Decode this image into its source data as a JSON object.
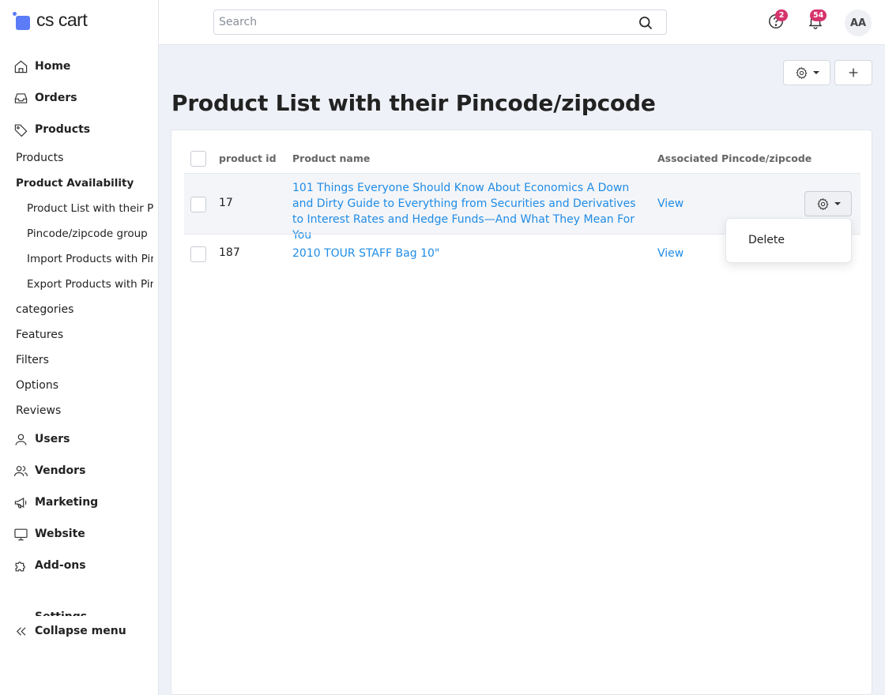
{
  "brand": {
    "name": "cs cart",
    "accent": "#5b7cf6"
  },
  "sidebar": {
    "top_items": [
      {
        "label": "Home",
        "icon": "home-icon"
      },
      {
        "label": "Orders",
        "icon": "inbox-icon"
      },
      {
        "label": "Products",
        "icon": "tag-icon"
      }
    ],
    "products_sub": [
      {
        "label": "Products"
      },
      {
        "label": "Product Availability by Pincode"
      },
      {
        "label": "Product List with their Pincode/zipcode"
      },
      {
        "label": "Pincode/zipcode group"
      },
      {
        "label": "Import Products with Pincode"
      },
      {
        "label": "Export Products with Pincode"
      },
      {
        "label": "categories"
      },
      {
        "label": "Features"
      },
      {
        "label": "Filters"
      },
      {
        "label": "Options"
      },
      {
        "label": "Reviews"
      }
    ],
    "bottom_items": [
      {
        "label": "Users",
        "icon": "user-icon"
      },
      {
        "label": "Vendors",
        "icon": "users-icon"
      },
      {
        "label": "Marketing",
        "icon": "megaphone-icon"
      },
      {
        "label": "Website",
        "icon": "monitor-icon"
      },
      {
        "label": "Add-ons",
        "icon": "puzzle-icon"
      }
    ],
    "clipped_item": "Settings",
    "collapse_label": "Collapse menu"
  },
  "topbar": {
    "search_placeholder": "Search",
    "help_badge": "2",
    "notifications_badge": "54",
    "avatar_initials": "AA",
    "badge_color": "#d6336c"
  },
  "page": {
    "title": "Product List with their Pincode/zipcode"
  },
  "table": {
    "headers": {
      "id": "product id",
      "name": "Product name",
      "pincode": "Associated Pincode/zipcode"
    },
    "rows": [
      {
        "id": "17",
        "name": "101 Things Everyone Should Know About Economics A Down and Dirty Guide to Everything from Securities and Derivatives to Interest Rates and Hedge Funds—And What They Mean For You",
        "pincode": "View"
      },
      {
        "id": "187",
        "name": "2010 TOUR STAFF Bag 10\"",
        "pincode": "View"
      }
    ],
    "link_color": "#1f8ce6"
  },
  "dropdown": {
    "delete_label": "Delete"
  }
}
